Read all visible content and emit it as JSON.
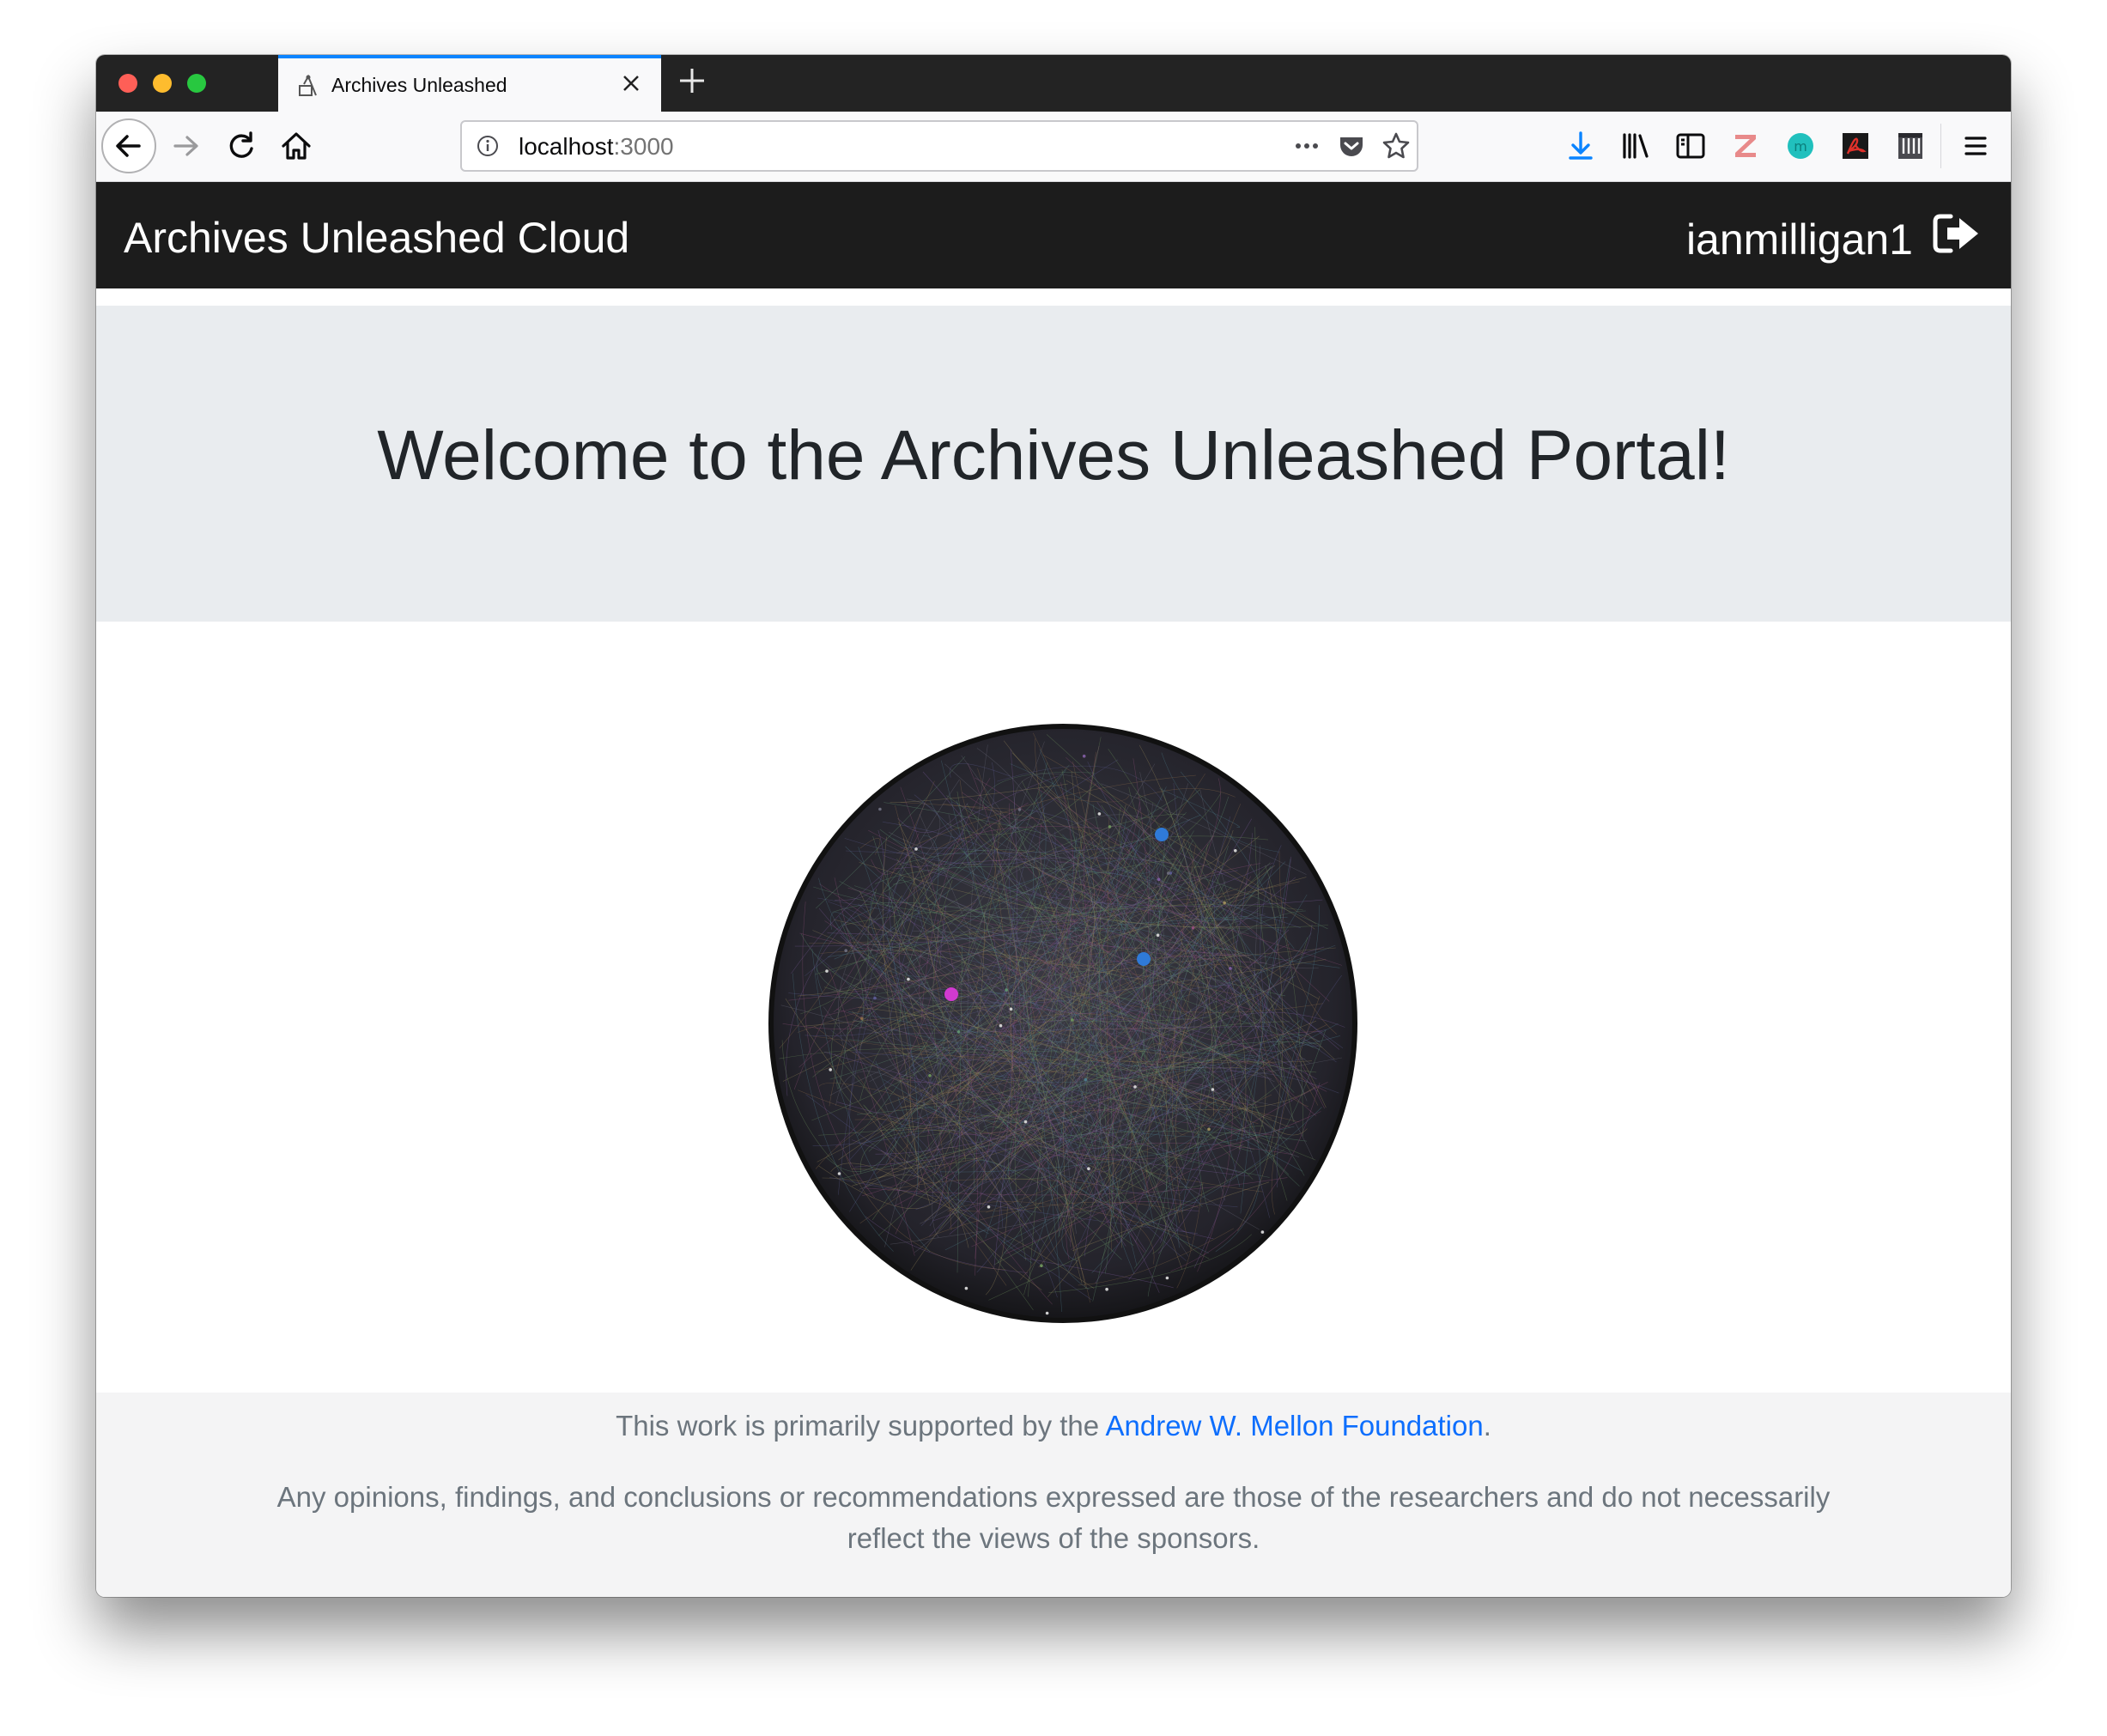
{
  "browser": {
    "tab_title": "Archives Unleashed",
    "url_host": "localhost",
    "url_port": ":3000"
  },
  "navbar": {
    "brand": "Archives Unleashed Cloud",
    "username": "ianmilligan1"
  },
  "jumbotron": {
    "heading": "Welcome to the Archives Unleashed Portal!"
  },
  "footer": {
    "support_prefix": "This work is primarily supported by the ",
    "support_link": "Andrew W. Mellon Foundation",
    "support_suffix": ".",
    "disclaimer": "Any opinions, findings, and conclusions or recommendations expressed are those of the researchers and do not necessarily reflect the views of the sponsors."
  },
  "colors": {
    "tab_accent": "#0a84ff",
    "navbar_bg": "#1c1c1c",
    "jumbotron_bg": "#e9ecef",
    "link": "#0d6efd",
    "download_icon": "#0a84ff"
  },
  "icons": {
    "toolbar": [
      "back-icon",
      "forward-icon",
      "reload-icon",
      "home-icon"
    ],
    "url_actions": [
      "more-icon",
      "pocket-icon",
      "bookmark-star-icon"
    ],
    "extensions": [
      "download-icon",
      "library-icon",
      "sidebar-icon",
      "zotero-icon",
      "extension-m-icon",
      "pdf-icon",
      "trash-icon",
      "menu-icon"
    ],
    "signout": "sign-out-icon"
  }
}
